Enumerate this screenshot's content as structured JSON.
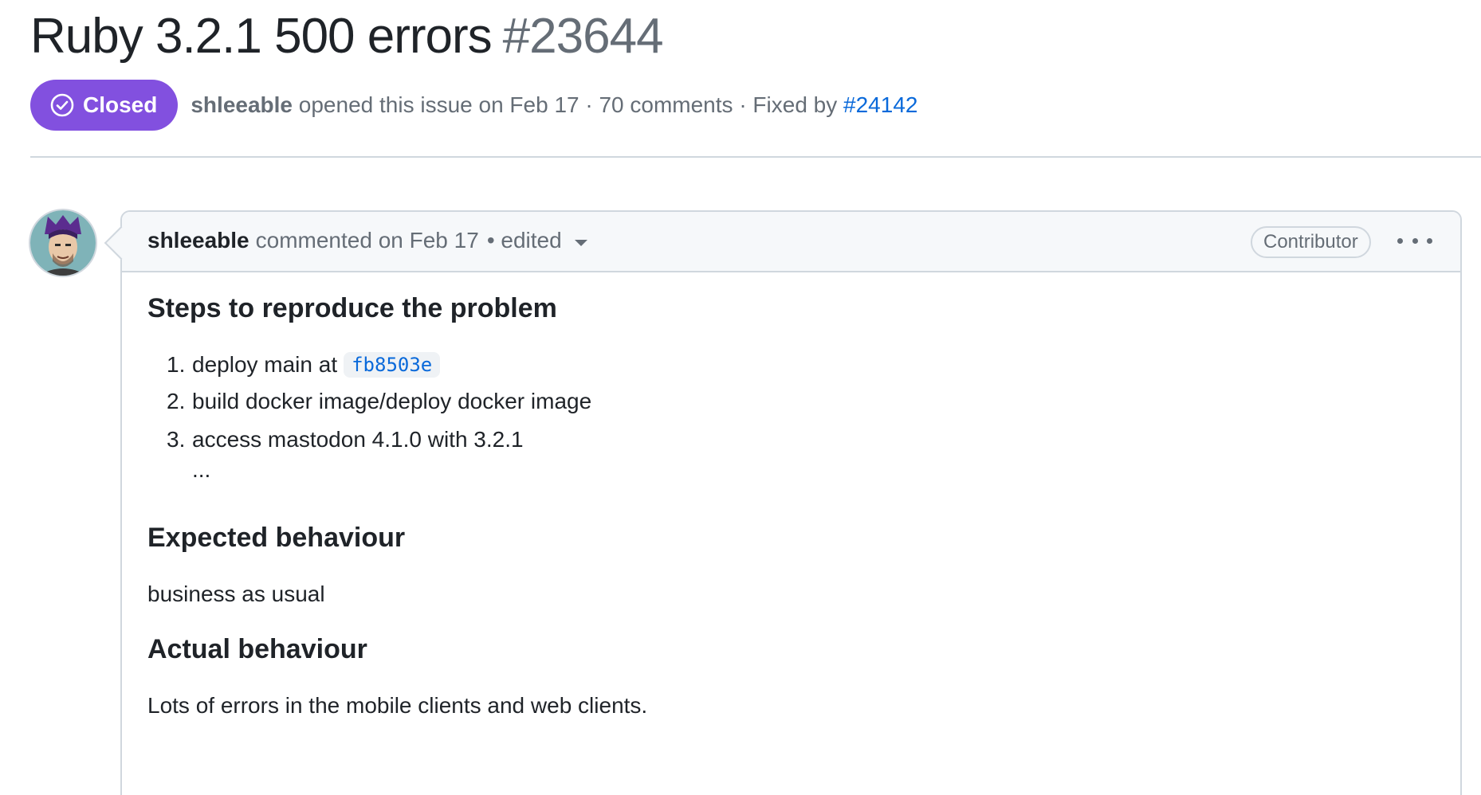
{
  "issue": {
    "title": "Ruby 3.2.1 500 errors",
    "number": "#23644"
  },
  "meta": {
    "state_label": "Closed",
    "state_color": "#8250df",
    "author": "shleeable",
    "opened_text": "opened this issue on Feb 17 · 70 comments · Fixed by",
    "fixed_by": "#24142"
  },
  "comment": {
    "author": "shleeable",
    "header_text": "commented on Feb 17",
    "edited_text": "• edited",
    "role_badge": "Contributor",
    "sections": {
      "steps_heading": "Steps to reproduce the problem",
      "steps": [
        {
          "num": "1.",
          "text": "deploy main at",
          "code": "fb8503e"
        },
        {
          "num": "2.",
          "text": "build docker image/deploy docker image"
        },
        {
          "num": "3.",
          "text": "access mastodon 4.1.0 with 3.2.1"
        }
      ],
      "steps_ellipsis": "...",
      "expected_heading": "Expected behaviour",
      "expected_text": "business as usual",
      "actual_heading": "Actual behaviour",
      "actual_text": "Lots of errors in the mobile clients and web clients."
    }
  },
  "icons": {
    "state": "check-circle-icon",
    "menu": "kebab-horizontal-icon",
    "dropdown": "caret-down-icon"
  },
  "colors": {
    "link": "#0969da",
    "muted": "#656d76",
    "border": "#d0d7de"
  }
}
